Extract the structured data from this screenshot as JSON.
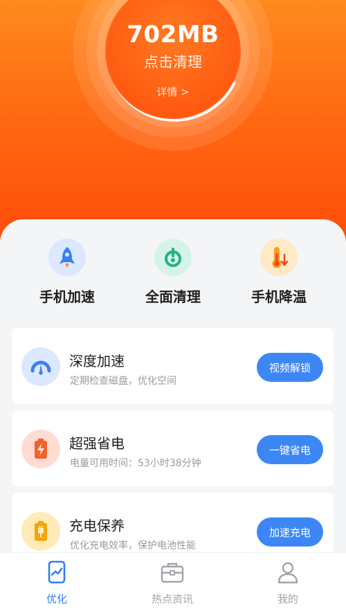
{
  "header": {
    "memory": "702MB",
    "clean_label": "点击清理",
    "detail_label": "详情 >"
  },
  "quick_actions": [
    {
      "label": "手机加速",
      "icon": "rocket-icon"
    },
    {
      "label": "全面清理",
      "icon": "broom-icon"
    },
    {
      "label": "手机降温",
      "icon": "thermometer-icon"
    }
  ],
  "cards": [
    {
      "title": "深度加速",
      "subtitle": "定期检查磁盘，优化空间",
      "button": "视频解锁",
      "icon": "speedometer-icon"
    },
    {
      "title": "超强省电",
      "subtitle": "电量可用时间：53小时38分钟",
      "button": "一键省电",
      "icon": "battery-charging-icon"
    },
    {
      "title": "充电保养",
      "subtitle": "优化充电效率，保护电池性能",
      "button": "加速充电",
      "icon": "battery-plug-icon"
    }
  ],
  "tabs": [
    {
      "label": "优化",
      "icon": "phone-chart-icon",
      "active": true
    },
    {
      "label": "热点资讯",
      "icon": "briefcase-icon",
      "active": false
    },
    {
      "label": "我的",
      "icon": "user-icon",
      "active": false
    }
  ],
  "colors": {
    "accent": "#3c87f5",
    "hero_top": "#ff8a1e",
    "hero_bottom": "#ff4b0a",
    "tab_active": "#2f7df6"
  }
}
